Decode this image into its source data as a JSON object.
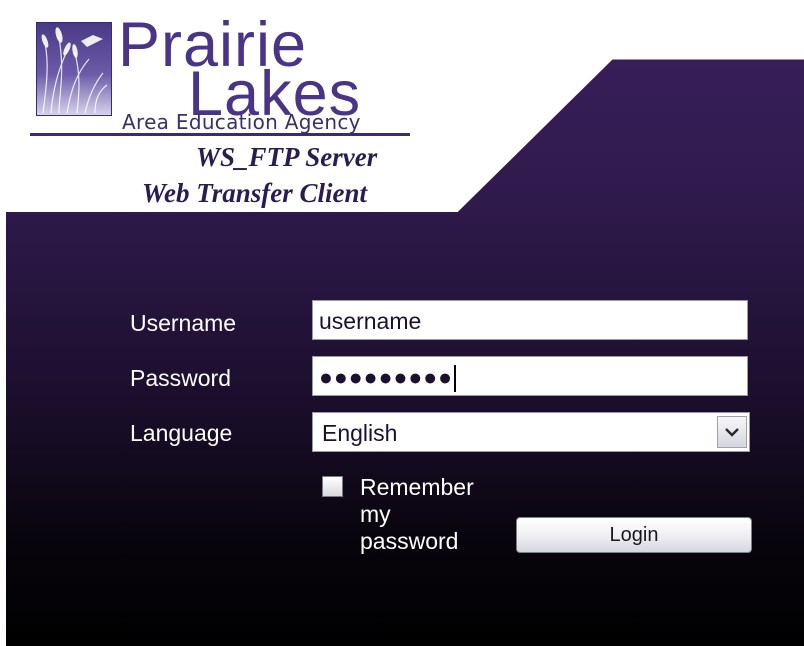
{
  "header": {
    "logo_line1": "Prairie",
    "logo_line2": "Lakes",
    "logo_tagline": "Area Education Agency",
    "subtitle1": "WS_FTP Server",
    "subtitle2": "Web Transfer Client"
  },
  "form": {
    "username_label": "Username",
    "username_value": "username",
    "password_label": "Password",
    "password_value": "●●●●●●●●●",
    "language_label": "Language",
    "language_value": "English",
    "remember_label": "Remember my password",
    "remember_checked": false,
    "login_label": "Login"
  },
  "icons": {
    "dropdown": "chevron-down-icon",
    "logo_graphic": "prairie-grass-logo-icon"
  },
  "colors": {
    "brand_purple": "#4a3488",
    "panel_top": "#3a1f5e",
    "panel_bottom": "#000000"
  }
}
